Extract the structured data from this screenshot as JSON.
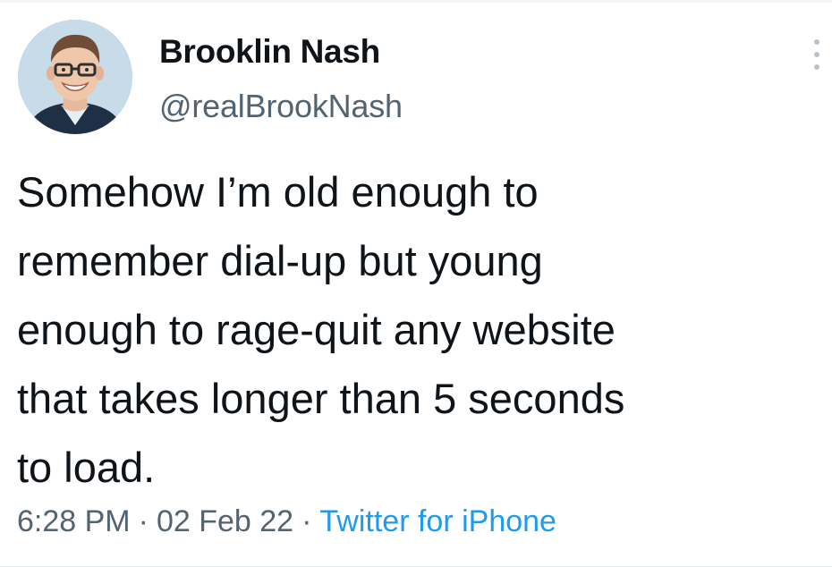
{
  "tweet": {
    "author": {
      "display_name": "Brooklin Nash",
      "handle": "@realBrookNash",
      "avatar_icon": "profile-photo"
    },
    "more_icon": "ellipsis-vertical-icon",
    "text": "Somehow I’m old enough to\nremember dial-up but young\nenough to rage-quit any website\nthat takes longer than 5 seconds\nto load.",
    "meta": {
      "time": "6:28 PM",
      "separator": "·",
      "date": "02 Feb 22",
      "source": "Twitter for iPhone"
    }
  },
  "colors": {
    "text_primary": "#0f1419",
    "text_secondary": "#536471",
    "link": "#1d9bf0",
    "background": "#ffffff"
  }
}
